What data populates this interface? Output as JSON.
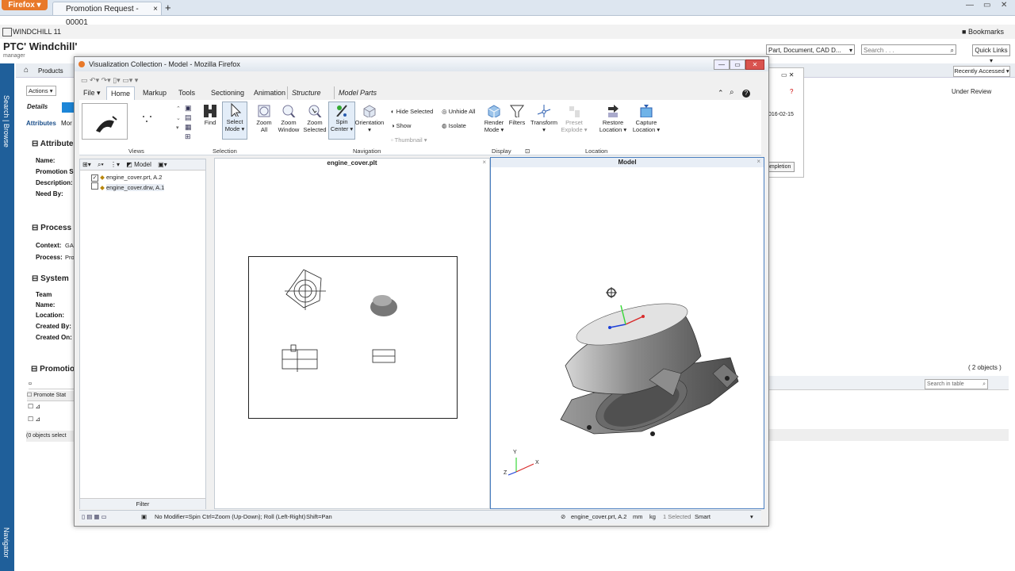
{
  "browser": {
    "menu_label": "Firefox",
    "tab_title": "Promotion Request - 00001",
    "tab_close": "×",
    "new_tab": "+",
    "win_min": "—",
    "win_max": "▭",
    "win_close": "✕"
  },
  "windchill": {
    "app_title": "WINDCHILL 11",
    "bookmarks": "Bookmarks",
    "logo": "PTC' Windchill'",
    "logo_sub": "manager",
    "search_type": "Part, Document, CAD D...",
    "search_placeholder": "Search . . .",
    "quick_links": "Quick Links",
    "recently_accessed": "Recently Accessed",
    "breadcrumb": "Products",
    "left_nav_search": "Search | Browse",
    "left_nav_navigator": "Navigator",
    "actions": "Actions",
    "tab_details": "Details",
    "tab_attributes": "Attributes",
    "tab_more": "Mor",
    "section_attributes": "Attributes",
    "attr_labels": [
      "Name:",
      "Promotion S",
      "Description:",
      "Need By:"
    ],
    "section_process": "Process",
    "process_labels": [
      "Context:",
      "Process:"
    ],
    "process_values": [
      "GA",
      "Pro"
    ],
    "section_system": "System",
    "system_labels": [
      "Team",
      "Name:",
      "Location:",
      "Created By:",
      "Created On:"
    ],
    "section_promotion": "Promotio",
    "promote_status_col": "Promote Stat",
    "objects_selected": "(0 objects select",
    "status_right": "Under Review",
    "date_right": "016-02-15",
    "completion": "ompletion",
    "two_objects": "( 2 objects )",
    "search_in_table": "Search in table",
    "pane_close": "×"
  },
  "popup": {
    "title": "Visualization Collection - Model - Mozilla Firefox",
    "file_menu": "File",
    "tabs": [
      "Home",
      "Markup",
      "Tools",
      "Sectioning",
      "Animation"
    ],
    "tab_structure": "Structure",
    "tab_model_parts": "Model Parts",
    "ribbon": {
      "find": "Find",
      "select_mode": [
        "Select",
        "Mode"
      ],
      "zoom_all": [
        "Zoom",
        "All"
      ],
      "zoom_window": [
        "Zoom",
        "Window"
      ],
      "zoom_selected": [
        "Zoom",
        "Selected"
      ],
      "spin_center": [
        "Spin",
        "Center"
      ],
      "orientation": "Orientation",
      "hide_selected": "Hide Selected",
      "unhide_all": "Unhide All",
      "show": "Show",
      "isolate": "Isolate",
      "thumbnail": "Thumbnail",
      "render_mode": [
        "Render",
        "Mode"
      ],
      "filters": "Filters",
      "transform": "Transform",
      "preset_explode": [
        "Preset",
        "Explode"
      ],
      "restore_location": [
        "Restore",
        "Location"
      ],
      "capture_location": [
        "Capture",
        "Location"
      ],
      "group_views": "Views",
      "group_selection": "Selection",
      "group_navigation": "Navigation",
      "group_display": "Display",
      "group_location": "Location"
    },
    "tree": {
      "model_label": "Model",
      "items": [
        {
          "label": "engine_cover.prt, A.2",
          "checked": true
        },
        {
          "label": "engine_cover.drw, A.1",
          "checked": false
        }
      ],
      "filter_label": "Filter"
    },
    "drawing_pane_title": "engine_cover.plt",
    "model_pane_title": "Model",
    "triad": {
      "y": "Y",
      "x": "X",
      "z": "Z"
    },
    "status": {
      "mode": "No Modifier=Spin",
      "hint": "Ctrl=Zoom (Up-Down); Roll (Left-Right)",
      "pan": "Shift=Pan",
      "part": "engine_cover.prt, A.2",
      "units_length": "mm",
      "units_mass": "kg",
      "selected": "1 Selected",
      "select_mode": "Smart"
    }
  }
}
